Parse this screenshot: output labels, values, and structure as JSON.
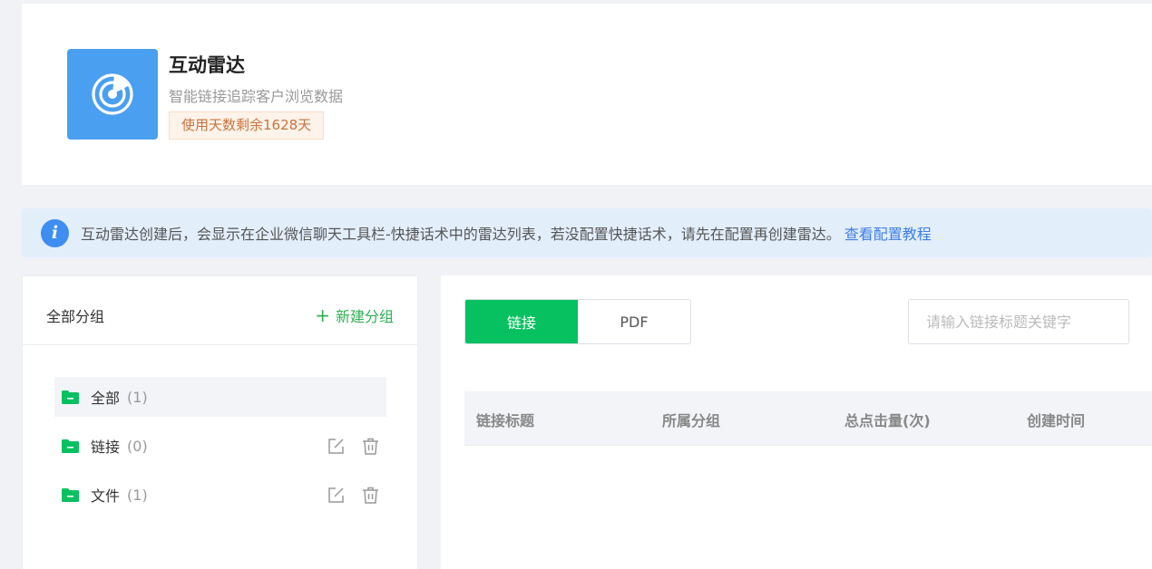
{
  "app": {
    "title": "互动雷达",
    "subtitle": "智能链接追踪客户浏览数据",
    "days_badge": "使用天数剩余1628天",
    "logo_icon": "radar-icon"
  },
  "banner": {
    "text": "互动雷达创建后，会显示在企业微信聊天工具栏-快捷话术中的雷达列表，若没配置快捷话术，请先在配置再创建雷达。",
    "link": "查看配置教程",
    "icon": "info-icon"
  },
  "groups": {
    "title": "全部分组",
    "new_button": "新建分组",
    "items": [
      {
        "name": "全部",
        "count": "(1)",
        "active": true
      },
      {
        "name": "链接",
        "count": "(0)"
      },
      {
        "name": "文件",
        "count": "(1)"
      }
    ]
  },
  "content": {
    "tabs": [
      "链接",
      "PDF"
    ],
    "search_placeholder": "请输入链接标题关键字",
    "columns": [
      "链接标题",
      "所属分组",
      "总点击量(次)",
      "创建时间"
    ]
  },
  "colors": {
    "accent_green": "#07c160",
    "logo_blue": "#4a9ff0",
    "link_blue": "#3d7ee8",
    "badge_orange": "#c9733c"
  }
}
